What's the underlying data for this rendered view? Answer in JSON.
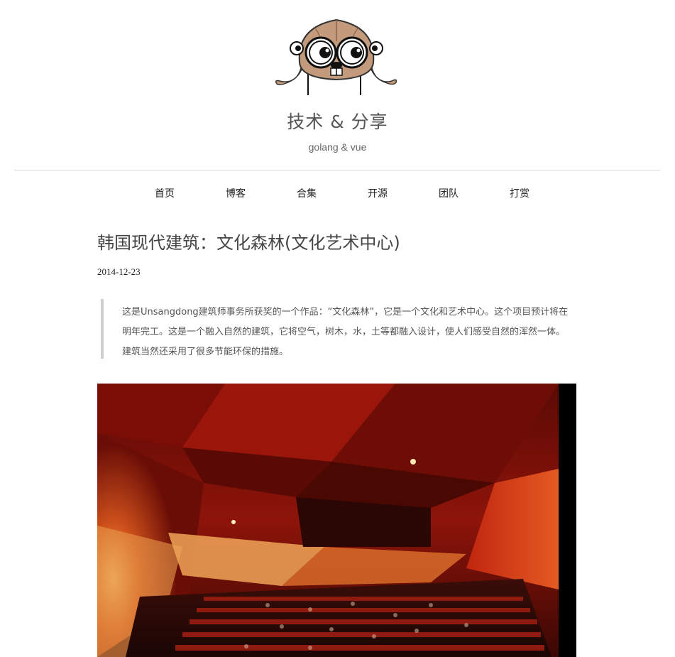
{
  "site": {
    "title": "技术 & 分享",
    "subtitle": "golang & vue"
  },
  "nav": {
    "items": [
      {
        "label": "首页"
      },
      {
        "label": "博客"
      },
      {
        "label": "合集"
      },
      {
        "label": "开源"
      },
      {
        "label": "团队"
      },
      {
        "label": "打赏"
      }
    ]
  },
  "post": {
    "title": "韩国现代建筑：文化森林(文化艺术中心)",
    "date": "2014-12-23",
    "quote": "这是Unsangdong建筑师事务所获奖的一个作品：“文化森林”，它是一个文化和艺术中心。这个项目预计将在明年完工。这是一个融入自然的建筑，它将空气，树木，水，土等都融入设计，使人们感受自然的浑然一体。建筑当然还采用了很多节能环保的措施。"
  },
  "colors": {
    "text": "#333333",
    "rule": "#d6d6d6",
    "quote_border": "#cfcfcf",
    "gopher": "#c39a7b",
    "hero_red": "#b5180c"
  },
  "icons": {
    "logo": "gopher-aviator-icon"
  }
}
